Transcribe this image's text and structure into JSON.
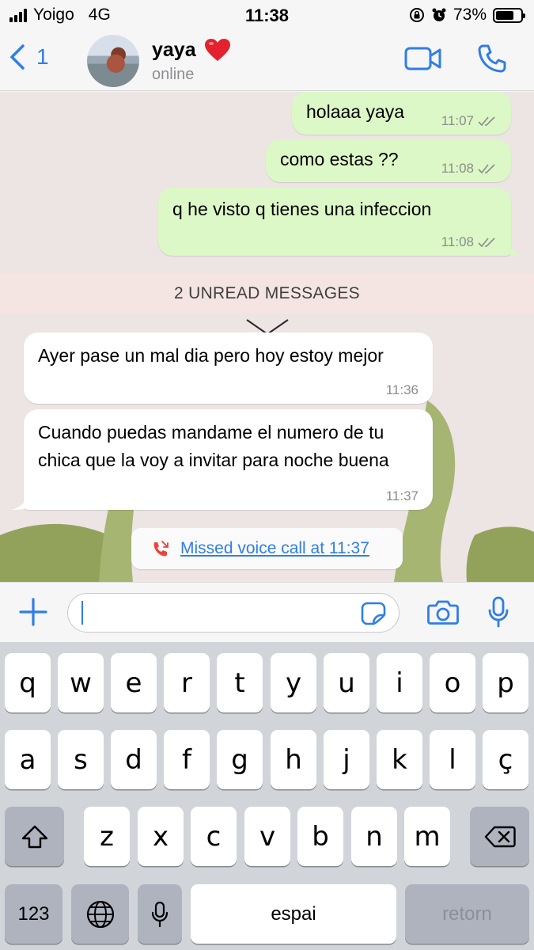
{
  "status_bar": {
    "carrier": "Yoigo",
    "network": "4G",
    "time": "11:38",
    "battery": "73%",
    "battery_level": 0.73
  },
  "header": {
    "back_count": "1",
    "contact_name": "yaya",
    "heart": "❤️",
    "status": "online",
    "video_icon": "video-camera-icon",
    "call_icon": "phone-icon"
  },
  "messages": [
    {
      "text": "holaaa yaya",
      "time": "11:07",
      "direction": "outgoing"
    },
    {
      "text": "como estas ??",
      "time": "11:08",
      "direction": "outgoing"
    },
    {
      "text": "q he visto q tienes una infeccion",
      "time": "11:08",
      "direction": "outgoing"
    },
    {
      "text": "Ayer pase un mal dia pero hoy estoy mejor",
      "time": "11:36",
      "direction": "incoming"
    },
    {
      "text": "Cuando puedas mandame el numero de tu chica que la voy a invitar para noche buena",
      "time": "11:37",
      "direction": "incoming"
    }
  ],
  "unread_banner": "2 UNREAD MESSAGES",
  "missed_call": "Missed voice call at 11:37",
  "input": {
    "value": "",
    "placeholder": ""
  },
  "keyboard": {
    "row1": [
      "q",
      "w",
      "e",
      "r",
      "t",
      "y",
      "u",
      "i",
      "o",
      "p"
    ],
    "row2": [
      "a",
      "s",
      "d",
      "f",
      "g",
      "h",
      "j",
      "k",
      "l",
      "ç"
    ],
    "row3": [
      "z",
      "x",
      "c",
      "v",
      "b",
      "n",
      "m"
    ],
    "numbers": "123",
    "space": "espai",
    "return": "retorn"
  },
  "colors": {
    "accent": "#2f7ee6",
    "outgoing_bubble": "#dcf8c6",
    "incoming_bubble": "#ffffff",
    "missed_call_red": "#e8453c",
    "read_ticks": "#8c8c8c"
  }
}
